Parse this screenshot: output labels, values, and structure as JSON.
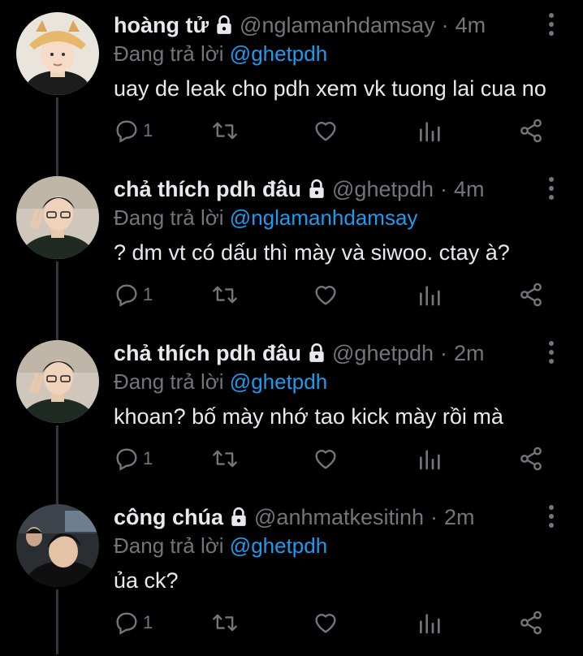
{
  "thread": [
    {
      "name": "hoàng tử",
      "handle": "@nglamanhdamsay",
      "sep": "·",
      "time": "4m",
      "reply_prefix": "Đang trả lời",
      "reply_to": "@ghetpdh",
      "text": "uay de leak cho pdh xem vk tuong lai cua no",
      "reply_count": "1"
    },
    {
      "name": "chả thích pdh đâu",
      "handle": "@ghetpdh",
      "sep": "·",
      "time": "4m",
      "reply_prefix": "Đang trả lời",
      "reply_to": "@nglamanhdamsay",
      "text": "? dm vt có dấu thì mày và siwoo. ctay à?",
      "reply_count": "1"
    },
    {
      "name": "chả thích pdh đâu",
      "handle": "@ghetpdh",
      "sep": "·",
      "time": "2m",
      "reply_prefix": "Đang trả lời",
      "reply_to": "@ghetpdh",
      "text": "khoan? bố mày nhớ tao kick mày rồi mà",
      "reply_count": "1"
    },
    {
      "name": "công chúa",
      "handle": "@anhmatkesitinh",
      "sep": "·",
      "time": "2m",
      "reply_prefix": "Đang trả lời",
      "reply_to": "@ghetpdh",
      "text": "ủa ck?",
      "reply_count": "1"
    }
  ],
  "theme": {
    "background": "#000000",
    "text": "#e7e9ea",
    "muted": "#71767b",
    "accent": "#1d9bf0",
    "thread_line": "#333639"
  },
  "icons": [
    "lock-icon",
    "more-icon",
    "reply-icon",
    "retweet-icon",
    "like-icon",
    "analytics-icon",
    "share-icon"
  ]
}
